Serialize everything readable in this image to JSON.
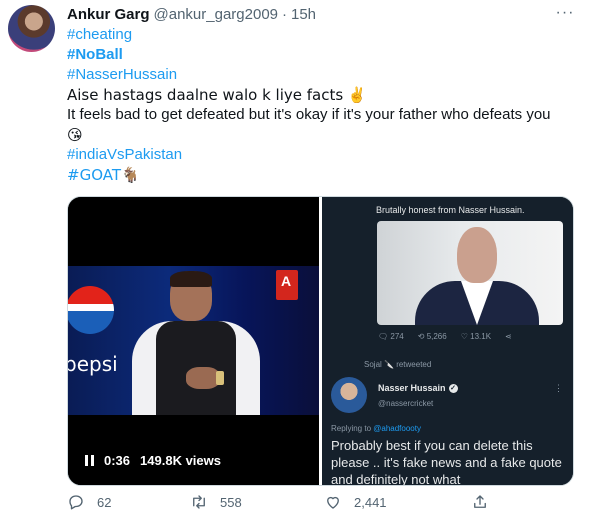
{
  "tweet": {
    "author_name": "Ankur Garg",
    "handle": "@ankur_garg2009",
    "separator": "·",
    "time": "15h",
    "more_label": "···",
    "lines": [
      "#cheating",
      "#NoBall",
      "#NasserHussain",
      "Aise hastags daalne walo k liye facts ✌️",
      "It feels bad to get defeated but it's okay if it's your father who defeats you",
      "😘",
      "#indiaVsPakistan",
      "#GOAT🐐"
    ]
  },
  "video": {
    "time": "0:36",
    "views": "149.8K views",
    "brand_text": "pepsi",
    "channel_badge": "A"
  },
  "screenshot": {
    "header_text": "Brutally honest from Nasser Hussain.",
    "stats": [
      "274",
      "5,266",
      "13.1K"
    ],
    "retweeted_text": "Sojal 🔪 retweeted",
    "quoted_name": "Nasser Hussain",
    "quoted_handle": "@nassercricket",
    "replying_label": "Replying to",
    "replying_handle": "@ahadfoooty",
    "quote_text": "Probably best if you can delete this please .. it's fake news and a fake quote and definitely not what"
  },
  "actions": {
    "replies": "62",
    "retweets": "558",
    "likes": "2,441"
  },
  "colors": {
    "accent": "#1d9bf0",
    "muted": "#536471",
    "text": "#0f1419"
  }
}
